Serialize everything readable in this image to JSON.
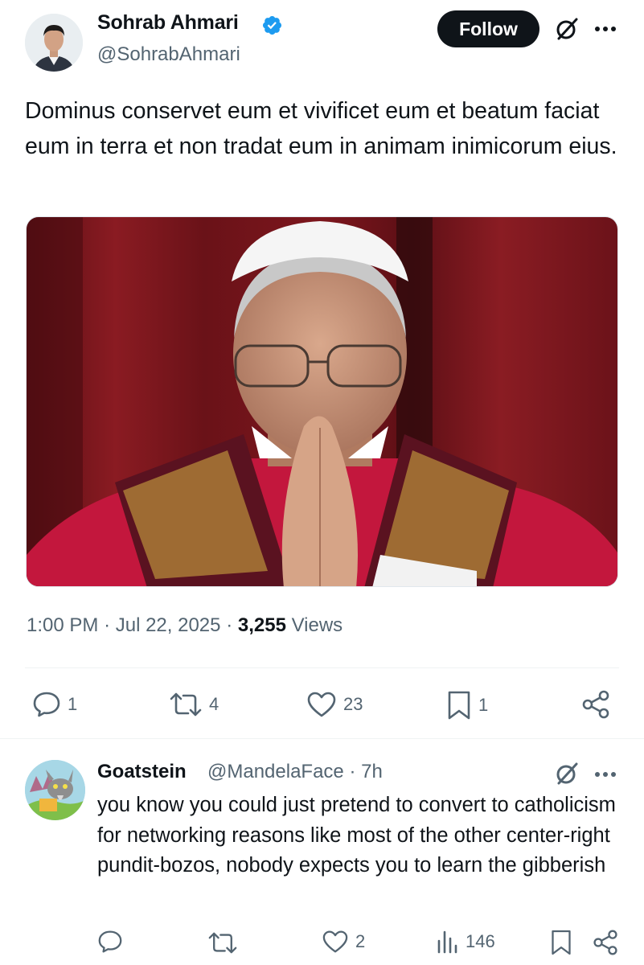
{
  "tweet": {
    "author_name": "Sohrab Ahmari",
    "author_handle": "@SohrabAhmari",
    "follow_label": "Follow",
    "text": "Dominus conservet eum et vivificet eum et beatum faciat eum in terra et non tradat eum in animam inimicorum eius.",
    "time": "1:00 PM",
    "separator": "·",
    "date": "Jul 22, 2025",
    "views_count": "3,255",
    "views_label": "Views",
    "stats": {
      "replies": "1",
      "reposts": "4",
      "likes": "23",
      "bookmarks": "1"
    },
    "icons": [
      "verified-badge-icon",
      "grok-icon",
      "more-icon",
      "reply-icon",
      "repost-icon",
      "like-icon",
      "bookmark-icon",
      "share-icon"
    ]
  },
  "reply": {
    "author_name": "Goatstein",
    "author_handle": "@MandelaFace",
    "separator": "·",
    "time": "7h",
    "text": "you know you could just pretend to convert to catholicism for networking reasons like most of the other center-right pundit-bozos, nobody expects you to learn the gibberish",
    "stats": {
      "likes": "2",
      "views": "146"
    },
    "icons": [
      "reply-icon",
      "repost-icon",
      "like-icon",
      "views-icon",
      "bookmark-icon",
      "share-icon"
    ]
  },
  "colors": {
    "text_primary": "#0f1419",
    "text_secondary": "#536471",
    "verified_blue": "#1d9bf0",
    "divider": "#eff3f4",
    "follow_button_bg": "#0f1419"
  }
}
